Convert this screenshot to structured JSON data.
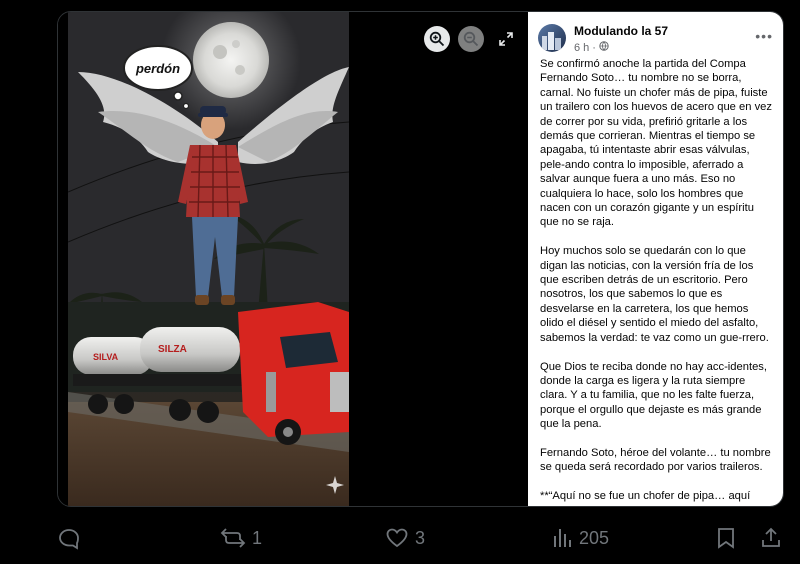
{
  "media": {
    "bubble_text": "perdón",
    "zoom_in_icon": "zoom-in-icon",
    "zoom_out_icon": "zoom-out-icon",
    "expand_icon": "expand-icon",
    "truck_text_1": "SILVA",
    "truck_text_2": "SILZA"
  },
  "post": {
    "page_name": "Modulando la 57",
    "time": "6 h",
    "dot": "·",
    "more": "•••",
    "paragraphs": [
      "Se confirmó anoche la partida del Compa Fernando Soto… tu nombre no se borra, carnal. No fuiste un chofer más de pipa, fuiste un trailero con los huevos de acero que en vez de correr por su vida, prefirió gritarle a los demás que corrieran. Mientras el tiempo se apagaba, tú intentaste abrir esas válvulas, pele-ando contra lo imposible, aferrado a salvar aunque fuera a uno más. Eso no cualquiera lo hace, solo los hombres que nacen con un corazón gigante y un espíritu que no se raja.",
      "Hoy muchos solo se quedarán con lo que digan las noticias, con la versión fría de los que escriben detrás de un escritorio. Pero nosotros, los que sabemos lo que es desvelarse en la carretera, los que hemos olido el diésel y sentido el miedo del asfalto, sabemos la verdad: te vaz como un gue-rrero.",
      "Que Dios te reciba donde no hay acc-identes, donde la carga es ligera y la ruta siempre clara. Y a tu familia, que no les falte fuerza, porque el orgullo que dejaste es más grande que la pena.",
      "Fernando Soto, héroe del volante… tu nombre se queda será recordado por varios traileros.",
      "**“Aquí no se fue un chofer de pipa… aquí nació una leyenda del asfalto.”**"
    ],
    "trailing": "."
  },
  "actions": {
    "reply_count": "",
    "repost_count": "1",
    "like_count": "3",
    "views_count": "205"
  },
  "colors": {
    "background": "#000000",
    "action_gray": "#71767b",
    "post_bg": "#ffffff"
  }
}
